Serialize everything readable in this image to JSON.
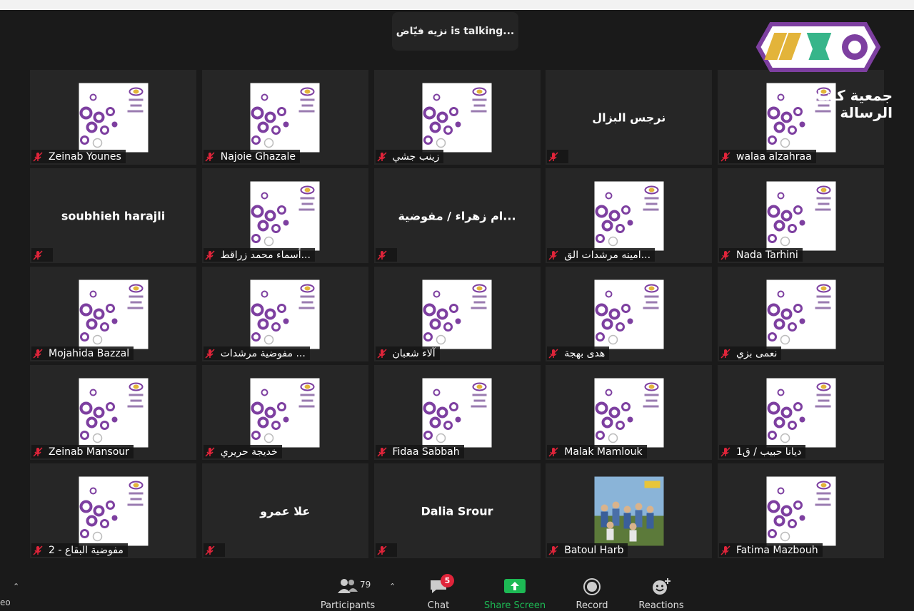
{
  "banner": {
    "speaker": "نزيه فيّاض",
    "suffix": "is  talking..."
  },
  "logo": {
    "text": "جمعية كشافة الرسالة",
    "colors": [
      "#7d3fa0",
      "#e3b43a",
      "#37b58a"
    ]
  },
  "participants": [
    {
      "name": "Zeinab Younes",
      "kind": "slide"
    },
    {
      "name": "Najoie Ghazale",
      "kind": "slide"
    },
    {
      "name": "زينب جشي",
      "kind": "slide"
    },
    {
      "name": "",
      "kind": "name",
      "display": "نرجس البزال"
    },
    {
      "name": "walaa alzahraa",
      "kind": "slide"
    },
    {
      "name": "",
      "kind": "name",
      "display": "soubhieh harajli"
    },
    {
      "name": "أسماء محمد زراقط...",
      "kind": "slide"
    },
    {
      "name": "",
      "kind": "name",
      "display": "ام زهراء / مفوضية..."
    },
    {
      "name": "امينه مرشدات الق...",
      "kind": "slide"
    },
    {
      "name": "Nada Tarhini",
      "kind": "slide"
    },
    {
      "name": "Mojahida Bazzal",
      "kind": "slide"
    },
    {
      "name": "مفوضية مرشدات ...",
      "kind": "slide"
    },
    {
      "name": "آلاء شعبان",
      "kind": "slide"
    },
    {
      "name": "هدى بهجة",
      "kind": "slide"
    },
    {
      "name": "نعمى بزي",
      "kind": "slide"
    },
    {
      "name": "Zeinab Mansour",
      "kind": "slide"
    },
    {
      "name": "خديجة حريري",
      "kind": "slide"
    },
    {
      "name": "Fidaa Sabbah",
      "kind": "slide"
    },
    {
      "name": "Malak Mamlouk",
      "kind": "slide"
    },
    {
      "name": "ديانا حبيب / ق1",
      "kind": "slide"
    },
    {
      "name": "مفوضية البقاع - 2",
      "kind": "slide"
    },
    {
      "name": "",
      "kind": "name",
      "display": "علا عمرو"
    },
    {
      "name": "",
      "kind": "name",
      "display": "Dalia Srour"
    },
    {
      "name": "Batoul Harb",
      "kind": "photo"
    },
    {
      "name": "Fatima Mazbouh",
      "kind": "slide"
    }
  ],
  "toolbar": {
    "participants": {
      "label": "Participants",
      "count": "79",
      "icon": "participants-icon"
    },
    "chat": {
      "label": "Chat",
      "badge": "5",
      "icon": "chat-icon"
    },
    "share": {
      "label": "Share Screen",
      "icon": "share-screen-icon",
      "color": "#1db954"
    },
    "record": {
      "label": "Record",
      "icon": "record-icon"
    },
    "reactions": {
      "label": "Reactions",
      "icon": "reactions-icon"
    }
  },
  "edge_text": "eo",
  "colors": {
    "background": "#1a1a1a",
    "tile": "#262626",
    "slide_purple": "#7d3fa0",
    "muted_red": "#e0243a"
  }
}
